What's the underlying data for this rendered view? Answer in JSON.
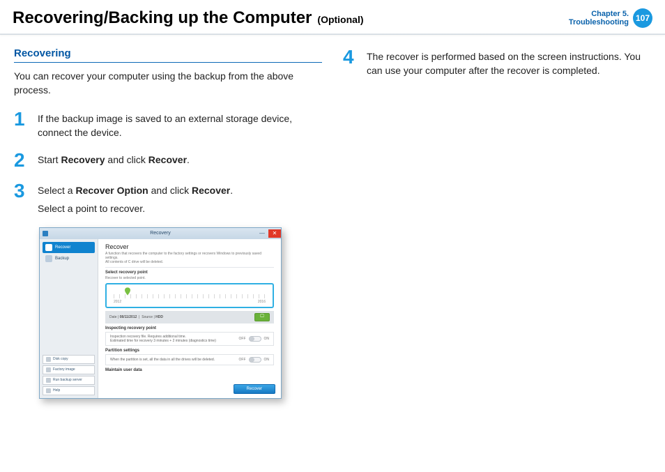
{
  "header": {
    "title": "Recovering/Backing up the Computer",
    "optional": "(Optional)",
    "chapter_line1": "Chapter 5.",
    "chapter_line2": "Troubleshooting",
    "page": "107"
  },
  "left": {
    "section": "Recovering",
    "intro": "You can recover your computer using the backup from the above process.",
    "steps": {
      "s1_num": "1",
      "s1": "If the backup image is saved to an external storage device, connect the device.",
      "s2_num": "2",
      "s2_a": "Start ",
      "s2_b": "Recovery",
      "s2_c": " and click ",
      "s2_d": "Recover",
      "s2_e": ".",
      "s3_num": "3",
      "s3_a": "Select a ",
      "s3_b": "Recover Option",
      "s3_c": " and click ",
      "s3_d": "Recover",
      "s3_e": ".",
      "s3_sub": "Select a point to recover."
    }
  },
  "right": {
    "s4_num": "4",
    "s4": "The recover is performed based on the screen instructions. You can use your computer after the recover is completed."
  },
  "screenshot": {
    "window_title": "Recovery",
    "side": {
      "recover": "Recover",
      "backup": "Backup",
      "disk_copy": "Disk copy",
      "factory_image": "Factory image",
      "run_backup_server": "Run backup server",
      "help": "Help"
    },
    "main": {
      "h1": "Recover",
      "desc_line1": "A function that recovers the computer to the factory settings or recovers Windows to previously saved settings.",
      "desc_line2": "All contents of C drive will be deleted.",
      "select_point": "Select recovery point",
      "recover_to": "Recover to selected point.",
      "year_a": "2012",
      "year_b": "2016",
      "date_label": "Date",
      "date_value": "08/11/2012",
      "source_label": "Source",
      "source_value": "HDD",
      "inspect_head": "Inspecting recovery point",
      "inspect_a": "Inspection recovery file. Requires additional time.",
      "inspect_b": "Estimated time for recovery 3 minutes + 2 minutes (diagnostics time)",
      "off": "OFF",
      "on": "ON",
      "partition_head": "Partition settings",
      "partition_body": "When the partition is set, all the data in all the drives will be deleted.",
      "maintain_head": "Maintain user data",
      "recover_btn": "Recover"
    }
  }
}
